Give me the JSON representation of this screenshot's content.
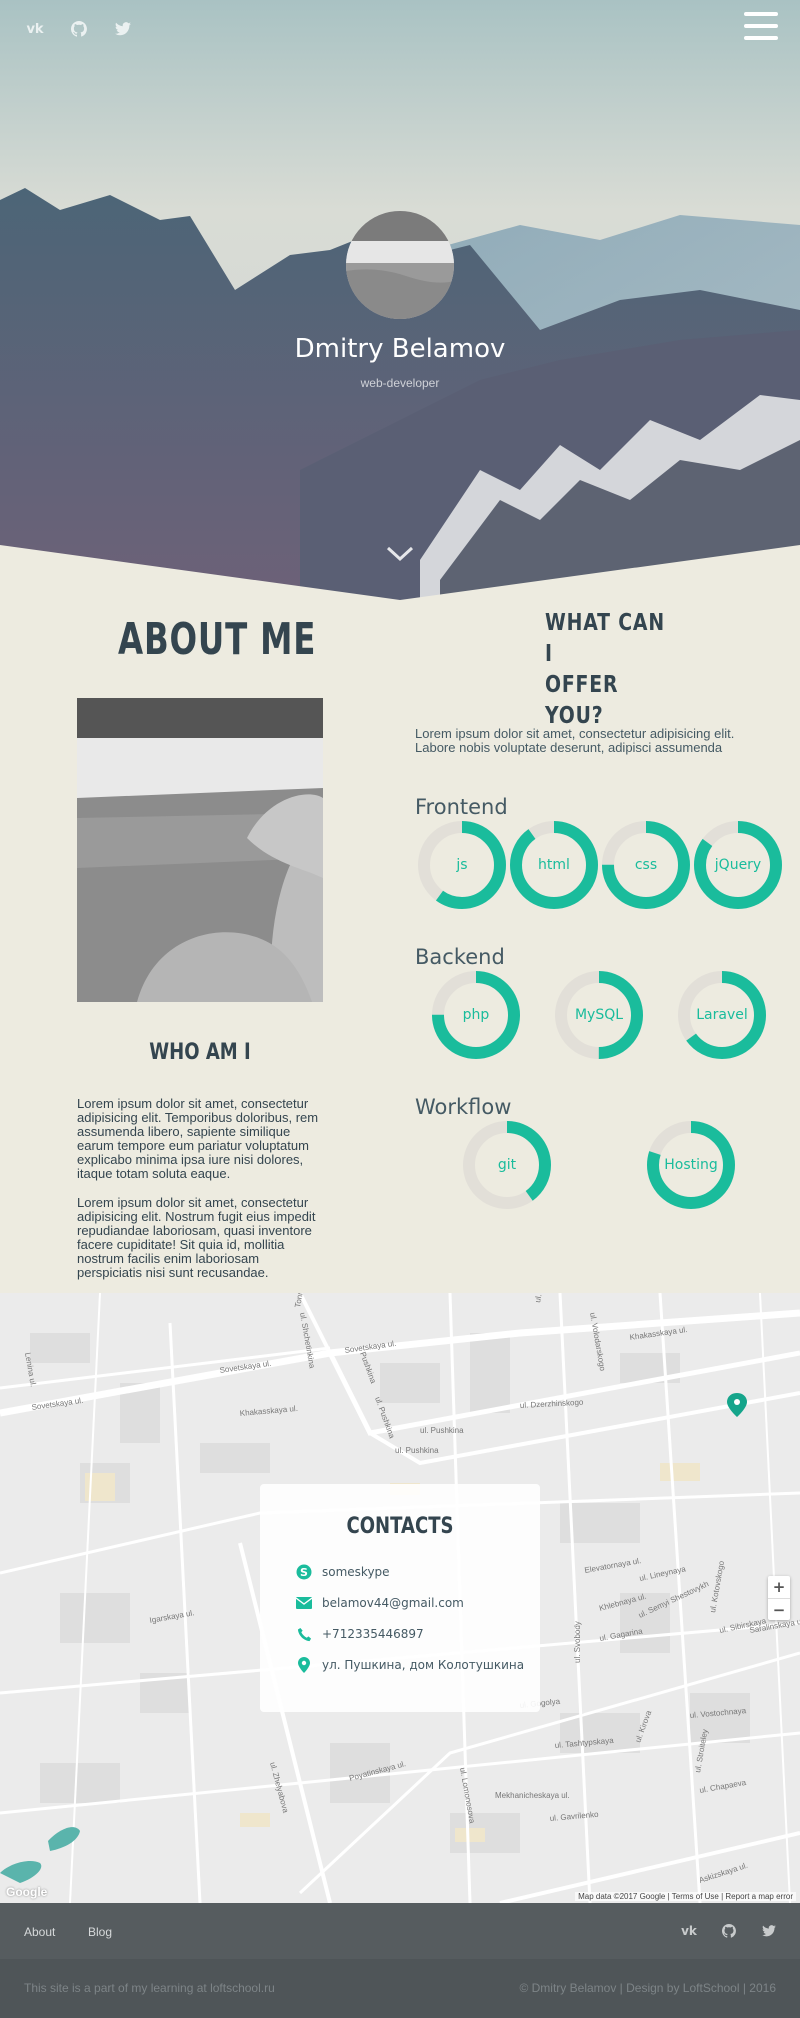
{
  "hero": {
    "name": "Dmitry Belamov",
    "role": "web-developer",
    "socials": [
      {
        "icon": "vk-icon",
        "glyph": "vk"
      },
      {
        "icon": "github-icon",
        "glyph": ""
      },
      {
        "icon": "twitter-icon",
        "glyph": ""
      }
    ]
  },
  "about": {
    "title": "ABOUT ME",
    "who_title": "WHO AM I",
    "paragraph_1": "Lorem ipsum dolor sit amet, consectetur adipisicing elit. Temporibus doloribus, rem assumenda libero, sapiente similique earum tempore eum pariatur voluptatum explicabo minima ipsa iure nisi dolores, itaque totam soluta eaque.",
    "paragraph_2": "Lorem ipsum dolor sit amet, consectetur adipisicing elit. Nostrum fugit eius impedit repudiandae laboriosam, quasi inventore facere cupiditate! Sit quia id, mollitia nostrum facilis enim laboriosam perspiciatis nisi sunt recusandae."
  },
  "offer": {
    "title_lines": [
      "WHAT CAN I",
      "OFFER",
      "YOU?"
    ],
    "text": "Lorem ipsum dolor sit amet, consectetur adipisicing elit. Labore nobis voluptate deserunt, adipisci assumenda"
  },
  "skills": {
    "frontend": {
      "title": "Frontend",
      "items": [
        {
          "label": "js",
          "level": 0.6
        },
        {
          "label": "html",
          "level": 0.9
        },
        {
          "label": "css",
          "level": 0.75
        },
        {
          "label": "jQuery",
          "level": 0.85
        }
      ]
    },
    "backend": {
      "title": "Backend",
      "items": [
        {
          "label": "php",
          "level": 0.75
        },
        {
          "label": "MySQL",
          "level": 0.5
        },
        {
          "label": "Laravel",
          "level": 0.65
        }
      ]
    },
    "workflow": {
      "title": "Workflow",
      "items": [
        {
          "label": "git",
          "level": 0.4
        },
        {
          "label": "Hosting",
          "level": 0.8
        }
      ]
    }
  },
  "contacts": {
    "title": "CONTACTS",
    "skype": "someskype",
    "email": "belamov44@gmail.com",
    "phone": "+712335446897",
    "address": "ул. Пушкина, дом Колотушкина"
  },
  "map": {
    "streets": [
      "Sovetskaya ul.",
      "Sovetskaya ul.",
      "Sovetskaya ul.",
      "ul. Pushkina",
      "ul. Pushkina",
      "ul. Pushkina",
      "ul. Dzerzhinskogo",
      "Khakasskaya ul.",
      "Khakasskaya ul.",
      "ul. Gagarina",
      "ul. Gogolya",
      "ul. Vostochnaya",
      "ul. Tashtypskaya",
      "ul. Lomonosova",
      "ul. Kirova",
      "Pushkina",
      "ul. Lineynaya",
      "ul. Sibirskaya",
      "Khlebnaya ul.",
      "Igarskaya ul.",
      "Elevatornaya ul.",
      "ul. Chapaeva",
      "ul. Kotovskogo",
      "ul. Zhelyabova",
      "Mekhanicheskaya ul.",
      "ul. Gavrilenko",
      "Askizskaya ul.",
      "ul. Shchetinkina",
      "ul. Stroiteley",
      "Poyatinskaya ul.",
      "Tonnel'naya ul.",
      "ul. Krasnaya",
      "ul. Volodarskogo",
      "ul. Svobody",
      "ul. Semyi Shestovykh",
      "Lenina ul.",
      "Saralinskaya ul."
    ],
    "attribution": "Map data ©2017 Google  |  Terms of Use  |  Report a map error",
    "logo": "Google",
    "zoom_in": "+",
    "zoom_out": "−"
  },
  "footer": {
    "nav": [
      "About",
      "Blog"
    ],
    "left_text": "This site is a part of my learning at loftschool.ru",
    "right_text": "© Dmitry Belamov | Design by LoftSchool | 2016"
  },
  "colors": {
    "accent": "#1abc9c",
    "ring_track": "#e2dfd8",
    "page_bg": "#edebe0",
    "heading": "#34454f"
  }
}
